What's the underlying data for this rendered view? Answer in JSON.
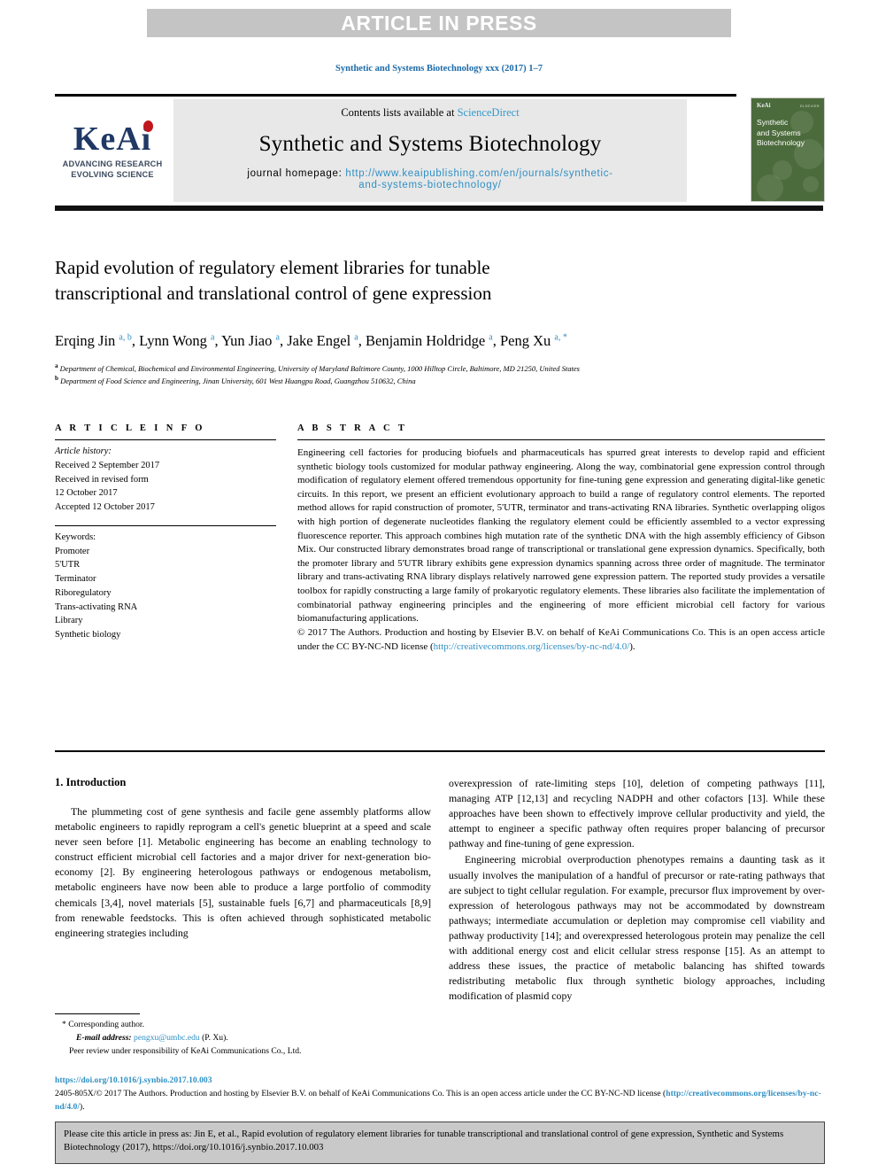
{
  "banner": {
    "text": "ARTICLE IN PRESS"
  },
  "running_head": "Synthetic and Systems Biotechnology xxx (2017) 1–7",
  "journal_header": {
    "contents_prefix": "Contents lists available at ",
    "contents_link": "ScienceDirect",
    "journal_title": "Synthetic and Systems Biotechnology",
    "homepage_label": "journal homepage: ",
    "homepage_url_line1": "http://www.keaipublishing.com/en/journals/synthetic-",
    "homepage_url_line2": "and-systems-biotechnology/",
    "logo": {
      "word": "KeAi",
      "tagline_line1": "ADVANCING RESEARCH",
      "tagline_line2": "EVOLVING SCIENCE",
      "color_navy": "#1f3864",
      "color_dot": "#c0161d"
    },
    "cover": {
      "keai_mark": "KeAi",
      "corner_text": "ELSEVIER",
      "title_line1": "Synthetic",
      "title_line2": "and Systems",
      "title_line3": "Biotechnology",
      "color": "#4c6b3c"
    }
  },
  "article": {
    "title_line1": "Rapid evolution of regulatory element libraries for tunable",
    "title_line2": "transcriptional and translational control of gene expression",
    "authors_html": "Erqing Jin <sup>a, b</sup>, Lynn Wong <sup>a</sup>, Yun Jiao <sup>a</sup>, Jake Engel <sup>a</sup>, Benjamin Holdridge <sup>a</sup>, Peng Xu <sup>a, *</sup>",
    "affiliation_a": "Department of Chemical, Biochemical and Environmental Engineering, University of Maryland Baltimore County, 1000 Hilltop Circle, Baltimore, MD 21250, United States",
    "affiliation_b": "Department of Food Science and Engineering, Jinan University, 601 West Huangpu Road, Guangzhou 510632, China"
  },
  "article_info": {
    "heading": "A R T I C L E   I N F O",
    "history_label": "Article history:",
    "history": [
      "Received 2 September 2017",
      "Received in revised form",
      "12 October 2017",
      "Accepted 12 October 2017"
    ],
    "keywords_label": "Keywords:",
    "keywords": [
      "Promoter",
      "5'UTR",
      "Terminator",
      "Riboregulatory",
      "Trans-activating RNA",
      "Library",
      "Synthetic biology"
    ]
  },
  "abstract": {
    "heading": "A B S T R A C T",
    "paragraph": "Engineering cell factories for producing biofuels and pharmaceuticals has spurred great interests to develop rapid and efficient synthetic biology tools customized for modular pathway engineering. Along the way, combinatorial gene expression control through modification of regulatory element offered tremendous opportunity for fine-tuning gene expression and generating digital-like genetic circuits. In this report, we present an efficient evolutionary approach to build a range of regulatory control elements. The reported method allows for rapid construction of promoter, 5'UTR, terminator and trans-activating RNA libraries. Synthetic overlapping oligos with high portion of degenerate nucleotides flanking the regulatory element could be efficiently assembled to a vector expressing fluorescence reporter. This approach combines high mutation rate of the synthetic DNA with the high assembly efficiency of Gibson Mix. Our constructed library demonstrates broad range of transcriptional or translational gene expression dynamics. Specifically, both the promoter library and 5'UTR library exhibits gene expression dynamics spanning across three order of magnitude. The terminator library and trans-activating RNA library displays relatively narrowed gene expression pattern. The reported study provides a versatile toolbox for rapidly constructing a large family of prokaryotic regulatory elements. These libraries also facilitate the implementation of combinatorial pathway engineering principles and the engineering of more efficient microbial cell factory for various biomanufacturing applications.",
    "copyright": "© 2017 The Authors. Production and hosting by Elsevier B.V. on behalf of KeAi Communications Co. This is an open access article under the CC BY-NC-ND license (",
    "license_link": "http://creativecommons.org/licenses/by-nc-nd/4.0/",
    "copyright_tail": ")."
  },
  "intro": {
    "heading": "1. Introduction",
    "left_paragraphs": [
      "The plummeting cost of gene synthesis and facile gene assembly platforms allow metabolic engineers to rapidly reprogram a cell's genetic blueprint at a speed and scale never seen before [1]. Metabolic engineering has become an enabling technology to construct efficient microbial cell factories and a major driver for next-generation bio-economy [2]. By engineering heterologous pathways or endogenous metabolism, metabolic engineers have now been able to produce a large portfolio of commodity chemicals [3,4], novel materials [5], sustainable fuels [6,7] and pharmaceuticals [8,9] from renewable feedstocks. This is often achieved through sophisticated metabolic engineering strategies including"
    ],
    "right_paragraphs": [
      "overexpression of rate-limiting steps [10], deletion of competing pathways [11], managing ATP [12,13] and recycling NADPH and other cofactors [13]. While these approaches have been shown to effectively improve cellular productivity and yield, the attempt to engineer a specific pathway often requires proper balancing of precursor pathway and fine-tuning of gene expression.",
      "Engineering microbial overproduction phenotypes remains a daunting task as it usually involves the manipulation of a handful of precursor or rate-rating pathways that are subject to tight cellular regulation. For example, precursor flux improvement by over-expression of heterologous pathways may not be accommodated by downstream pathways; intermediate accumulation or depletion may compromise cell viability and pathway productivity [14]; and overexpressed heterologous protein may penalize the cell with additional energy cost and elicit cellular stress response [15]. As an attempt to address these issues, the practice of metabolic balancing has shifted towards redistributing metabolic flux through synthetic biology approaches, including modification of plasmid copy"
    ]
  },
  "footnotes": {
    "corresponding": "* Corresponding author.",
    "email_label": "E-mail address:",
    "email": "pengxu@umbc.edu",
    "email_suffix": "(P. Xu).",
    "peer_review": "Peer review under responsibility of KeAi Communications Co., Ltd."
  },
  "doi_footer": {
    "doi": "https://doi.org/10.1016/j.synbio.2017.10.003",
    "copyright_line1": "2405-805X/© 2017 The Authors. Production and hosting by Elsevier B.V. on behalf of KeAi Communications Co. This is an open access article under the CC BY-NC-ND license",
    "license_open": "(",
    "license_link": "http://creativecommons.org/licenses/by-nc-nd/4.0/",
    "license_close": ")."
  },
  "citation_box": {
    "text": "Please cite this article in press as: Jin E, et al., Rapid evolution of regulatory element libraries for tunable transcriptional and translational control of gene expression, Synthetic and Systems Biotechnology (2017), https://doi.org/10.1016/j.synbio.2017.10.003"
  }
}
